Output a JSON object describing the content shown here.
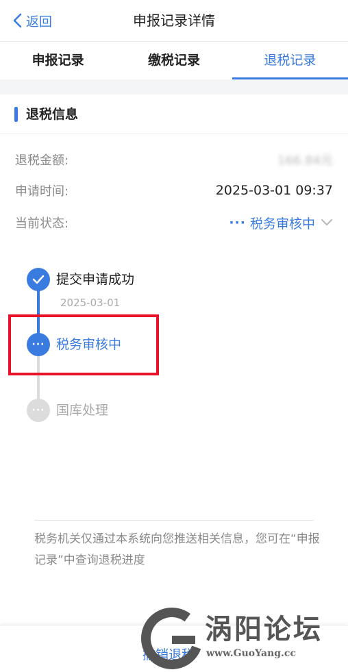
{
  "nav": {
    "back_label": "返回",
    "title": "申报记录详情"
  },
  "tabs": [
    {
      "label": "申报记录",
      "active": false
    },
    {
      "label": "缴税记录",
      "active": false
    },
    {
      "label": "退税记录",
      "active": true
    }
  ],
  "section": {
    "title": "退税信息"
  },
  "info": {
    "amount_label": "退税金额:",
    "amount_value": "166.84元",
    "time_label": "申请时间:",
    "time_value": "2025-03-01 09:37",
    "status_label": "当前状态:",
    "status_dots": "···",
    "status_value": "税务审核中"
  },
  "timeline": [
    {
      "label": "提交申请成功",
      "date": "2025-03-01",
      "state": "done"
    },
    {
      "label": "税务审核中",
      "date": "",
      "state": "current",
      "dots": "···"
    },
    {
      "label": "国库处理",
      "date": "",
      "state": "pending",
      "dots": "···"
    }
  ],
  "notice": "税务机关仅通过本系统向您推送相关信息，您可在“申报记录”中查询退税进度",
  "bottom": {
    "button_label": "撤销退税"
  },
  "watermark": {
    "text": "涡阳论坛",
    "url": "www.GuoYang.cc"
  },
  "colors": {
    "accent": "#3a7be0",
    "highlight": "#e8132a",
    "pending": "#dcdcdc"
  }
}
